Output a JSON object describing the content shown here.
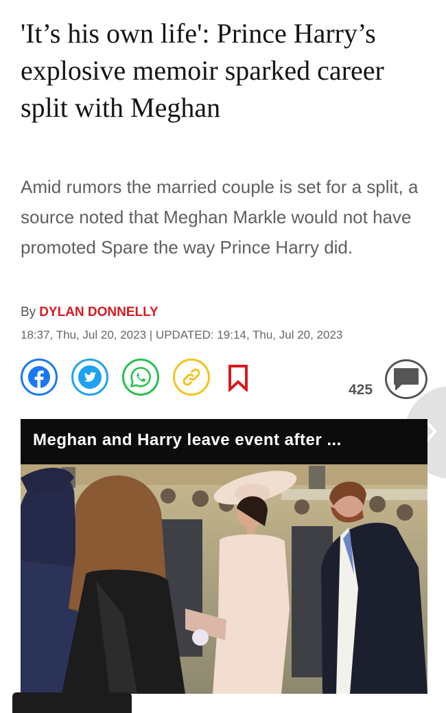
{
  "article": {
    "headline": "'It’s his own life': Prince Harry’s explosive memoir sparked career split with Meghan",
    "standfirst": "Amid rumors the married couple is set for a split, a source noted that Meghan Markle would not have promoted Spare the way Prince Harry did.",
    "byline_prefix": "By",
    "author": "DYLAN DONNELLY",
    "timestamp": "18:37, Thu, Jul 20, 2023 | UPDATED: 19:14, Thu, Jul 20, 2023"
  },
  "share": {
    "icons": [
      "facebook-icon",
      "twitter-icon",
      "whatsapp-icon",
      "link-icon",
      "bookmark-icon"
    ],
    "comment_count": "425",
    "colors": {
      "facebook": "#1877f2",
      "twitter": "#1da1f2",
      "whatsapp": "#25c04d",
      "link": "#f5c21b",
      "bookmark": "#d71920",
      "author": "#d71920"
    }
  },
  "video": {
    "title": "Meghan and Harry leave event after ..."
  }
}
